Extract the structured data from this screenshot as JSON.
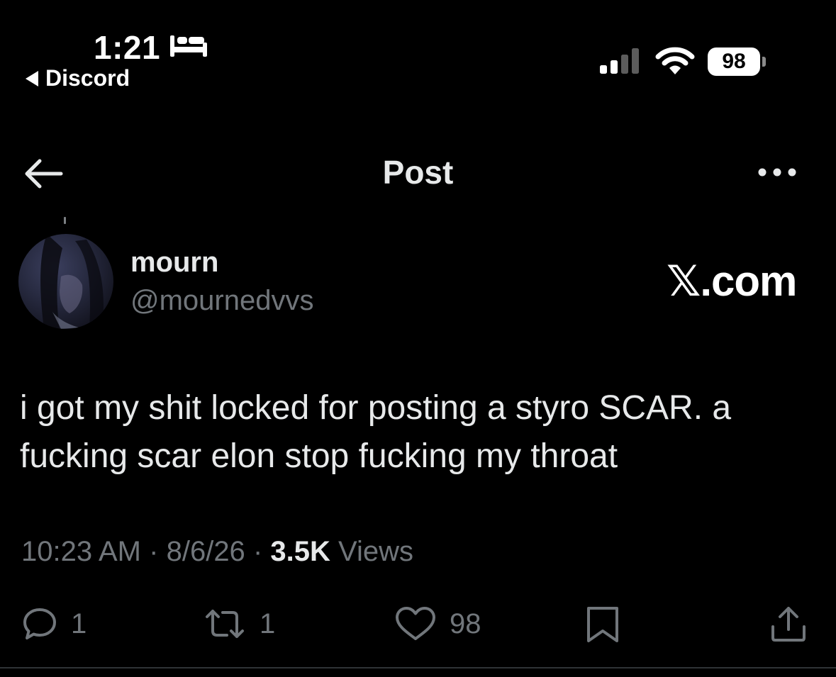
{
  "status_bar": {
    "time": "1:21",
    "back_app": "Discord",
    "battery": "98",
    "icons": [
      "bed-icon",
      "cellular-signal-icon",
      "wifi-icon",
      "battery-icon"
    ]
  },
  "header": {
    "title": "Post",
    "icons": [
      "back-arrow-icon",
      "more-options-icon"
    ]
  },
  "author": {
    "name": "mourn",
    "handle": "@mournedvvs"
  },
  "watermark": "𝕏.com",
  "post": {
    "text": "i got my shit locked for posting a styro SCAR. a fucking scar elon stop fucking my throat"
  },
  "meta": {
    "time": "10:23 AM",
    "separator": "·",
    "date": "8/6/26",
    "views_count": "3.5K",
    "views_label": "Views"
  },
  "actions": {
    "replies": "1",
    "reposts": "1",
    "likes": "98",
    "icons": [
      "reply-icon",
      "repost-icon",
      "like-icon",
      "bookmark-icon",
      "share-icon"
    ]
  },
  "colors": {
    "background": "#000000",
    "primary_text": "#e7e9ea",
    "secondary_text": "#71767b"
  }
}
